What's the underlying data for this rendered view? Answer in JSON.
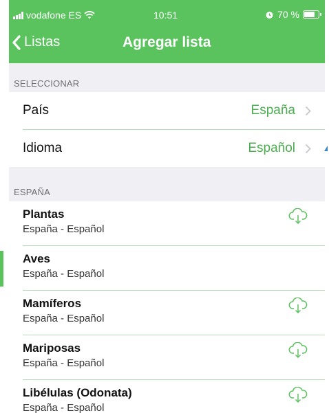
{
  "status": {
    "carrier": "vodafone ES",
    "time": "10:51",
    "battery": "70 %",
    "battery_level": 0.7
  },
  "nav": {
    "back_label": "Listas",
    "title": "Agregar lista"
  },
  "select_section": {
    "header": "SELECCIONAR",
    "rows": [
      {
        "label": "País",
        "value": "España"
      },
      {
        "label": "Idioma",
        "value": "Español"
      }
    ]
  },
  "list_section": {
    "header": "ESPAÑA",
    "items": [
      {
        "title": "Plantas",
        "subtitle": "España - Español",
        "download": true
      },
      {
        "title": "Aves",
        "subtitle": "España - Español",
        "download": false
      },
      {
        "title": "Mamíferos",
        "subtitle": "España - Español",
        "download": true
      },
      {
        "title": "Mariposas",
        "subtitle": "España - Español",
        "download": true
      },
      {
        "title": "Libélulas (Odonata)",
        "subtitle": "España - Español",
        "download": true
      }
    ]
  },
  "colors": {
    "accent": "#5ac35e",
    "value_text": "#4cae50",
    "section_bg": "#efeff4"
  },
  "icons": {
    "back": "chevron-left-icon",
    "disclosure": "chevron-right-icon",
    "download": "cloud-download-icon"
  }
}
